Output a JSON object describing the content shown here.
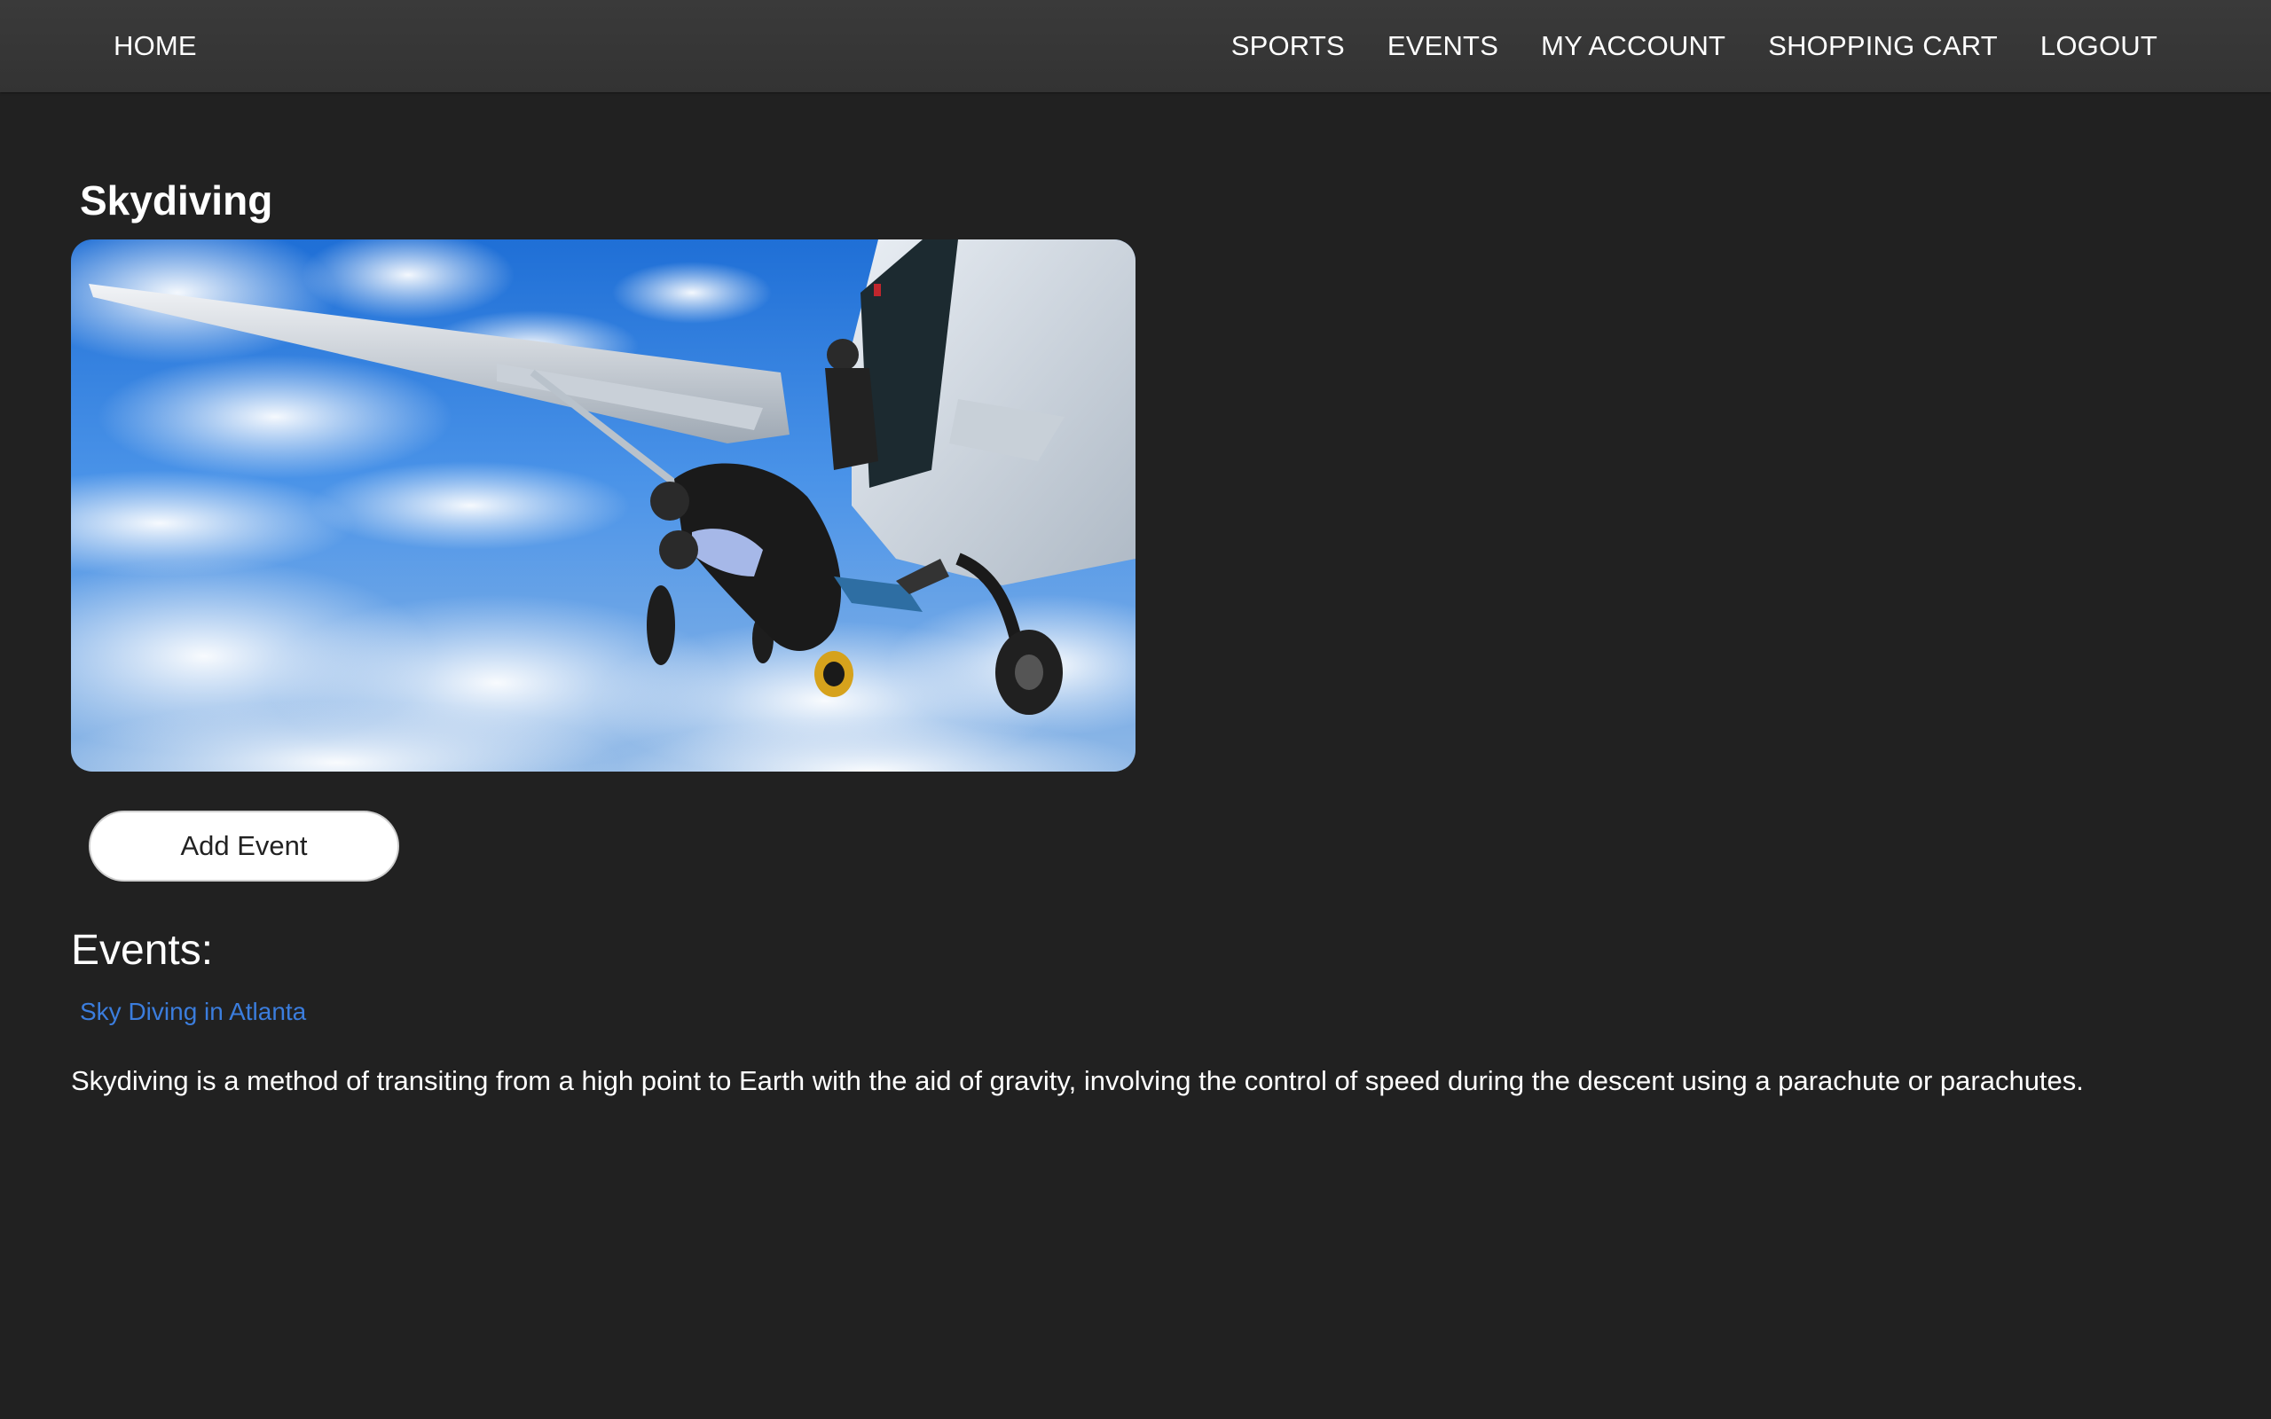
{
  "nav": {
    "home": "HOME",
    "sports": "SPORTS",
    "events": "EVENTS",
    "my_account": "MY ACCOUNT",
    "shopping_cart": "SHOPPING CART",
    "logout": "LOGOUT"
  },
  "sport": {
    "title": "Skydiving",
    "image_alt": "Tandem skydivers jumping from an airplane above the clouds",
    "add_event_label": "Add Event",
    "events_heading": "Events:",
    "events": [
      {
        "name": "Sky Diving in Atlanta"
      }
    ],
    "description": "Skydiving is a method of transiting from a high point to Earth with the aid of gravity, involving the control of speed during the descent using a parachute or parachutes."
  },
  "colors": {
    "background": "#212121",
    "navbar": "#353535",
    "link": "#3b7ddd",
    "button_bg": "#ffffff"
  }
}
